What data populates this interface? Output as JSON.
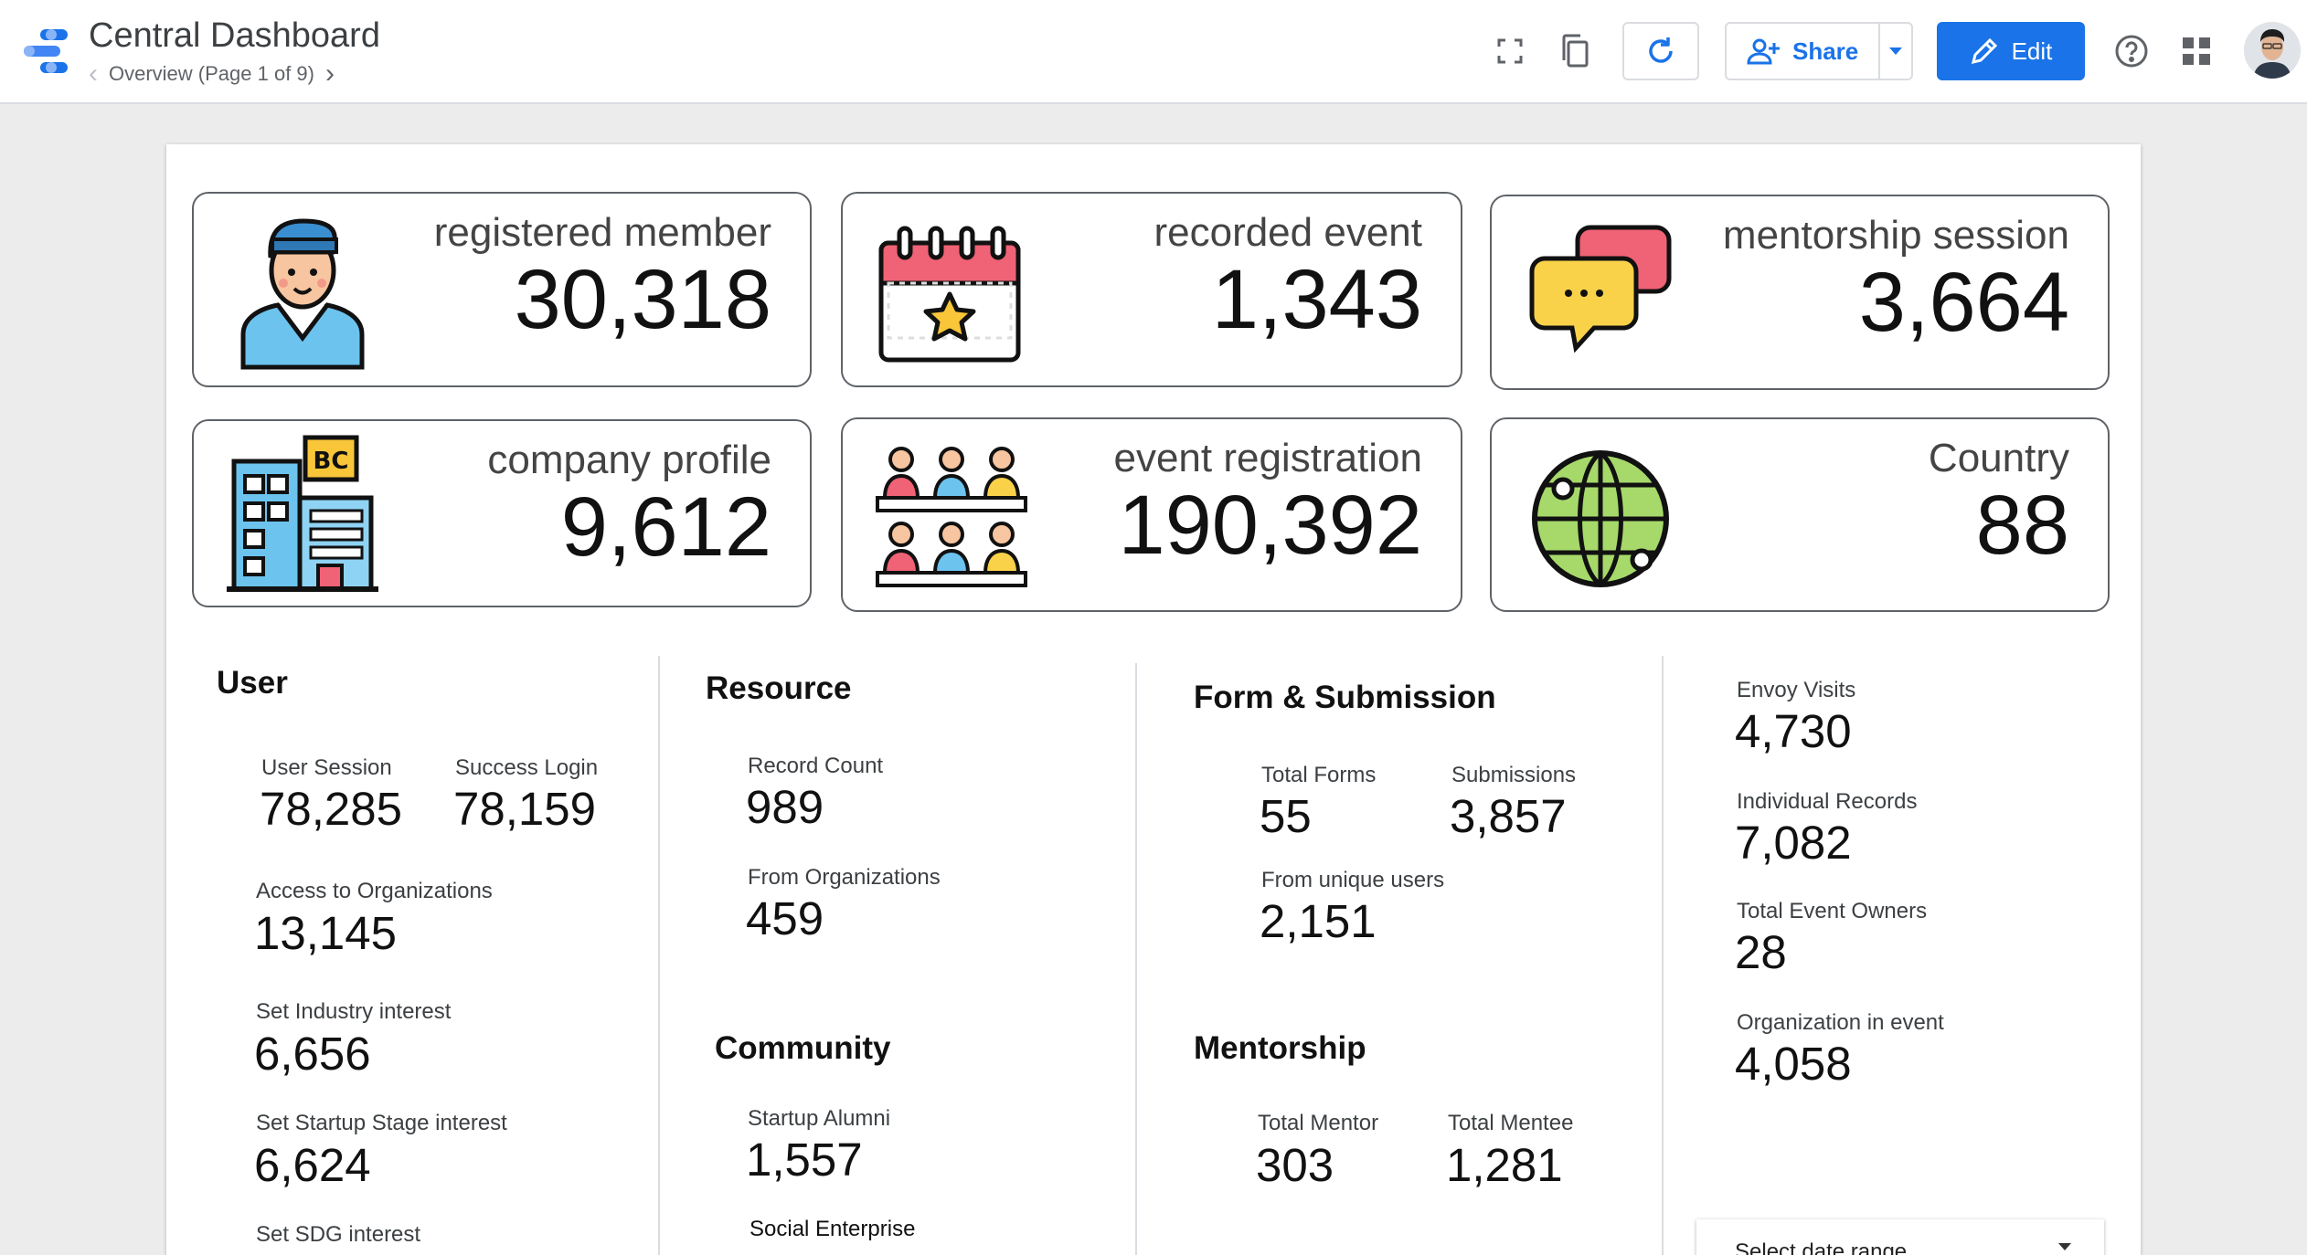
{
  "header": {
    "app_title": "Central Dashboard",
    "page_label": "Overview (Page 1 of 9)",
    "share_label": "Share",
    "edit_label": "Edit",
    "accent_color": "#1a73e8",
    "icons": [
      "datastudio-logo-icon",
      "fullscreen-icon",
      "copy-icon",
      "refresh-icon",
      "add-person-icon",
      "pencil-icon",
      "help-icon",
      "apps-grid-icon"
    ]
  },
  "scorecards": [
    {
      "label": "registered member",
      "value": "30,318",
      "icon": "member-icon"
    },
    {
      "label": "recorded event",
      "value": "1,343",
      "icon": "calendar-star-icon"
    },
    {
      "label": "mentorship session",
      "value": "3,664",
      "icon": "chat-bubbles-icon"
    },
    {
      "label": "company profile",
      "value": "9,612",
      "icon": "building-icon"
    },
    {
      "label": "event registration",
      "value": "190,392",
      "icon": "audience-icon"
    },
    {
      "label": "Country",
      "value": "88",
      "icon": "globe-icon"
    }
  ],
  "user": {
    "title": "User",
    "user_session": {
      "label": "User Session",
      "value": "78,285"
    },
    "success_login": {
      "label": "Success Login",
      "value": "78,159"
    },
    "access_orgs": {
      "label": "Access to Organizations",
      "value": "13,145"
    },
    "industry": {
      "label": "Set Industry interest",
      "value": "6,656"
    },
    "startup_stage": {
      "label": "Set Startup Stage interest",
      "value": "6,624"
    },
    "sdg": {
      "label": "Set SDG interest"
    }
  },
  "resource": {
    "title": "Resource",
    "record_count": {
      "label": "Record Count",
      "value": "989"
    },
    "from_orgs": {
      "label": "From Organizations",
      "value": "459"
    }
  },
  "community": {
    "title": "Community",
    "startup_alumni": {
      "label": "Startup Alumni",
      "value": "1,557"
    },
    "social_enterprise": {
      "label": "Social Enterprise"
    }
  },
  "forms": {
    "title": "Form & Submission",
    "total_forms": {
      "label": "Total Forms",
      "value": "55"
    },
    "submissions": {
      "label": "Submissions",
      "value": "3,857"
    },
    "unique_users": {
      "label": "From unique users",
      "value": "2,151"
    }
  },
  "mentorship": {
    "title": "Mentorship",
    "total_mentor": {
      "label": "Total Mentor",
      "value": "303"
    },
    "total_mentee": {
      "label": "Total Mentee",
      "value": "1,281"
    }
  },
  "right": {
    "envoy_visits": {
      "label": "Envoy Visits",
      "value": "4,730"
    },
    "individual_records": {
      "label": "Individual Records",
      "value": "7,082"
    },
    "event_owners": {
      "label": "Total Event Owners",
      "value": "28"
    },
    "org_in_event": {
      "label": "Organization in event",
      "value": "4,058"
    },
    "date_range_placeholder": "Select date range"
  }
}
